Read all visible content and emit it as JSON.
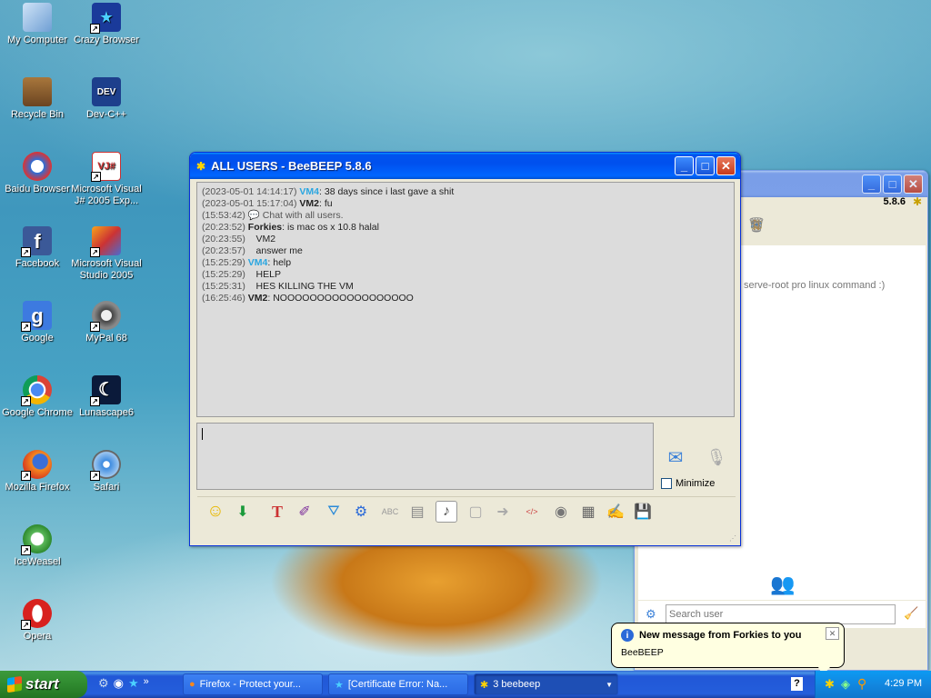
{
  "desktop": {
    "icons": [
      {
        "label": "My Computer"
      },
      {
        "label": "Crazy Browser"
      },
      {
        "label": "Recycle Bin"
      },
      {
        "label": "Dev-C++"
      },
      {
        "label": "Baidu Browser"
      },
      {
        "label": "Microsoft Visual J# 2005 Exp..."
      },
      {
        "label": "Facebook"
      },
      {
        "label": "Microsoft Visual Studio 2005"
      },
      {
        "label": "Google"
      },
      {
        "label": "MyPal 68"
      },
      {
        "label": "Google Chrome"
      },
      {
        "label": "Lunascape6"
      },
      {
        "label": "Mozilla Firefox"
      },
      {
        "label": "Safari"
      },
      {
        "label": "IceWeasel"
      },
      {
        "label": "Opera"
      }
    ],
    "icon_glyphs": {
      "dev": "DEV",
      "g": "g",
      "f": "f"
    }
  },
  "back_window": {
    "version": "5.8.6",
    "status_text": "serve-root pro linux command :)",
    "search_placeholder": "Search user",
    "buttons": {
      "minimize": "_",
      "maximize": "□",
      "close": "✕"
    }
  },
  "chat_window": {
    "title": "ALL USERS - BeeBEEP 5.8.6",
    "buttons": {
      "minimize": "_",
      "maximize": "□",
      "close": "✕"
    },
    "messages": [
      {
        "time": "(2023-05-01 14:14:17)",
        "user": "VM4",
        "text": ": 38 days since i last gave a shit"
      },
      {
        "time": "(2023-05-01 15:17:04)",
        "user": "VM2",
        "text": ": fu"
      },
      {
        "time": "(15:53:42)",
        "user": "",
        "text": "Chat with all users."
      },
      {
        "time": "(20:23:52)",
        "user": "Forkies",
        "text": ": is mac os x 10.8 halal"
      },
      {
        "time": "(20:23:55)",
        "user": "",
        "text": "VM2"
      },
      {
        "time": "(20:23:57)",
        "user": "",
        "text": "answer me"
      },
      {
        "time": "(15:25:29)",
        "user": "VM4",
        "text": ": help"
      },
      {
        "time": "(15:25:29)",
        "user": "",
        "text": "HELP"
      },
      {
        "time": "(15:25:31)",
        "user": "",
        "text": "HES KILLING THE VM"
      },
      {
        "time": "(16:25:46)",
        "user": "VM2",
        "text": ": NOOOOOOOOOOOOOOOOOO"
      }
    ],
    "minimize_label": "Minimize"
  },
  "taskbar": {
    "start_label": "start",
    "chevron": "»",
    "tasks": [
      {
        "label": "Firefox - Protect your..."
      },
      {
        "label": "[Certificate Error: Na..."
      },
      {
        "label": "3 beebeep"
      }
    ],
    "clock": "4:29 PM",
    "help": "?"
  },
  "notification": {
    "title": "New message from Forkies to you",
    "body": "BeeBEEP",
    "close": "✕",
    "info_icon": "i"
  }
}
